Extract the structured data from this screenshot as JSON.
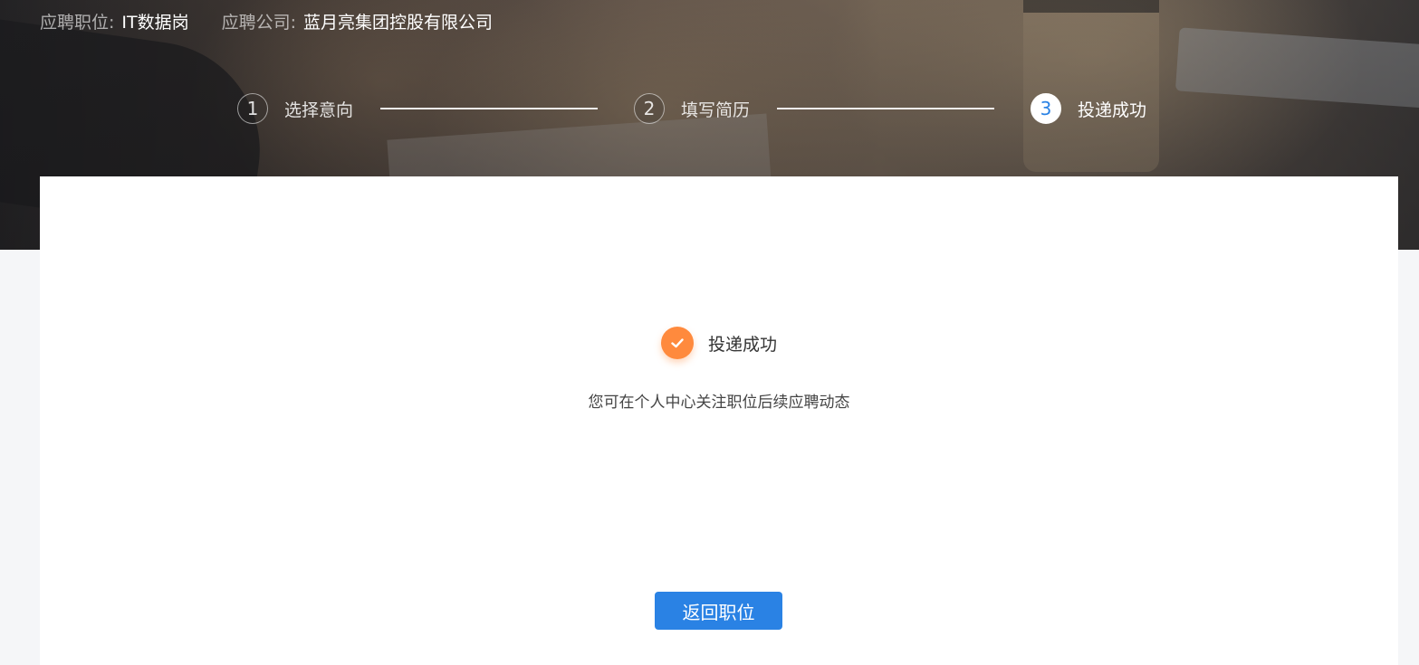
{
  "header": {
    "position_label": "应聘职位:",
    "position_value": "IT数据岗",
    "company_label": "应聘公司:",
    "company_value": "蓝月亮集团控股有限公司"
  },
  "steps": [
    {
      "number": "1",
      "label": "选择意向",
      "active": false
    },
    {
      "number": "2",
      "label": "填写简历",
      "active": false
    },
    {
      "number": "3",
      "label": "投递成功",
      "active": true
    }
  ],
  "result": {
    "icon": "check-circle-icon",
    "title": "投递成功",
    "subtitle": "您可在个人中心关注职位后续应聘动态"
  },
  "actions": {
    "back_label": "返回职位"
  },
  "colors": {
    "primary": "#2a82e4",
    "success_accent": "#ff8a3d"
  }
}
